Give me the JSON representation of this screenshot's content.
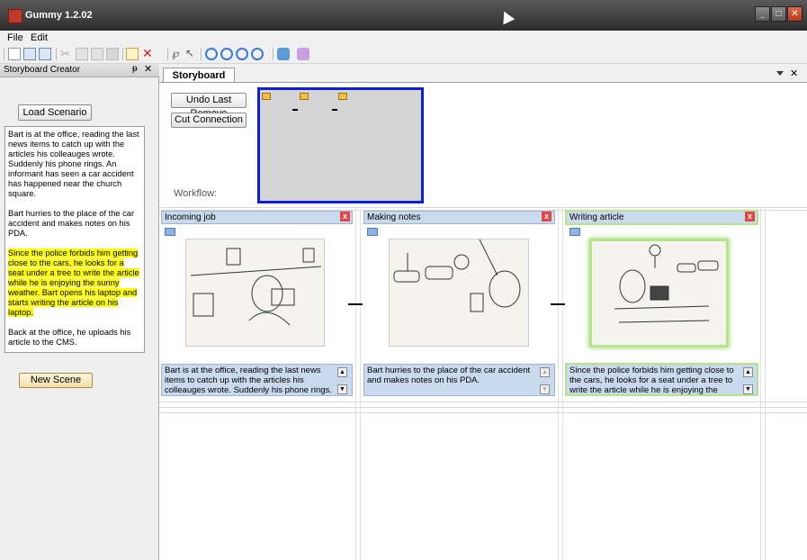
{
  "window": {
    "title": "Gummy 1.2.02",
    "min": "_",
    "max": "□",
    "close": "✕"
  },
  "menu": [
    "File",
    "Edit"
  ],
  "left_panel": {
    "title": "Storyboard Creator",
    "pin": "ᵽ",
    "close": "✕",
    "load_button": "Load Scenario",
    "scenario_paragraphs": [
      "Bart is at the office, reading the last news items to catch up with the articles his colleauges wrote. Suddenly his phone rings. An informant has seen a car accident has happened near the church square.",
      "Bart hurries to the place of the car accident and makes notes on his PDA.",
      "Since the police forbids him getting close to the cars, he looks for a seat under a tree to write the article while he is enjoying the sunny weather. Bart opens his laptop and starts writing the article on his laptop.",
      "Back at the office, he uploads his article to the CMS."
    ],
    "new_scene_button": "New Scene"
  },
  "tab": {
    "label": "Storyboard",
    "close": "✕"
  },
  "storyboard": {
    "undo_button": "Undo Last Remove",
    "cut_button": "Cut Connection",
    "workflow_label": "Workflow:",
    "scenes": [
      {
        "title": "Incoming job",
        "close": "x",
        "description": "Bart is at the office, reading the last news items to catch up with the articles his colleauges wrote. Suddenly his phone rings.",
        "selected": false
      },
      {
        "title": "Making notes",
        "close": "x",
        "description": "Bart hurries to the place of the car accident and makes notes on his PDA.",
        "selected": false
      },
      {
        "title": "Writing article",
        "close": "x",
        "description": "Since the police forbids him getting close to the cars, he looks for a seat under a tree to write the article while he is enjoying the sunny",
        "selected": true
      }
    ]
  },
  "colors": {
    "workflow_border": "#0a1fd6",
    "highlight": "#ffff00",
    "scene_header": "#c9d9ee",
    "selected_glow": "#b5e48a"
  }
}
